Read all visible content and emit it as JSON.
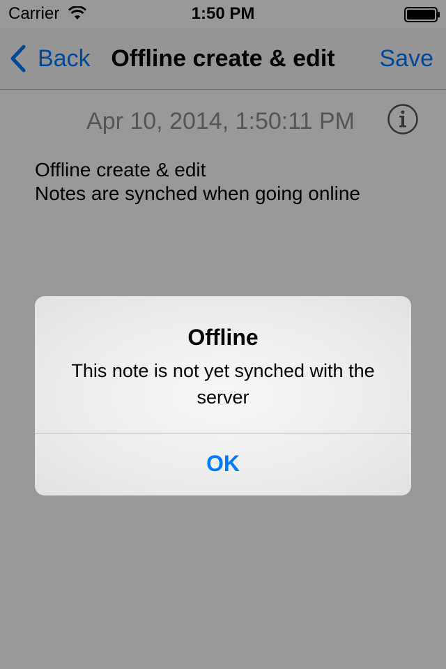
{
  "status_bar": {
    "carrier": "Carrier",
    "time": "1:50 PM",
    "wifi_icon": "wifi-icon",
    "battery_icon": "battery-icon"
  },
  "nav_bar": {
    "back_label": "Back",
    "title": "Offline create & edit",
    "save_label": "Save",
    "back_icon": "chevron-left-icon"
  },
  "note": {
    "date": "Apr 10, 2014, 1:50:11 PM",
    "info_icon": "info-icon",
    "lines": [
      "Offline create & edit",
      "Notes are synched when going online"
    ]
  },
  "alert": {
    "title": "Offline",
    "message": "This note is not yet synched with the server",
    "ok_label": "OK"
  },
  "colors": {
    "accent": "#007aff",
    "dim_overlay": "rgba(0,0,0,0.4)"
  }
}
